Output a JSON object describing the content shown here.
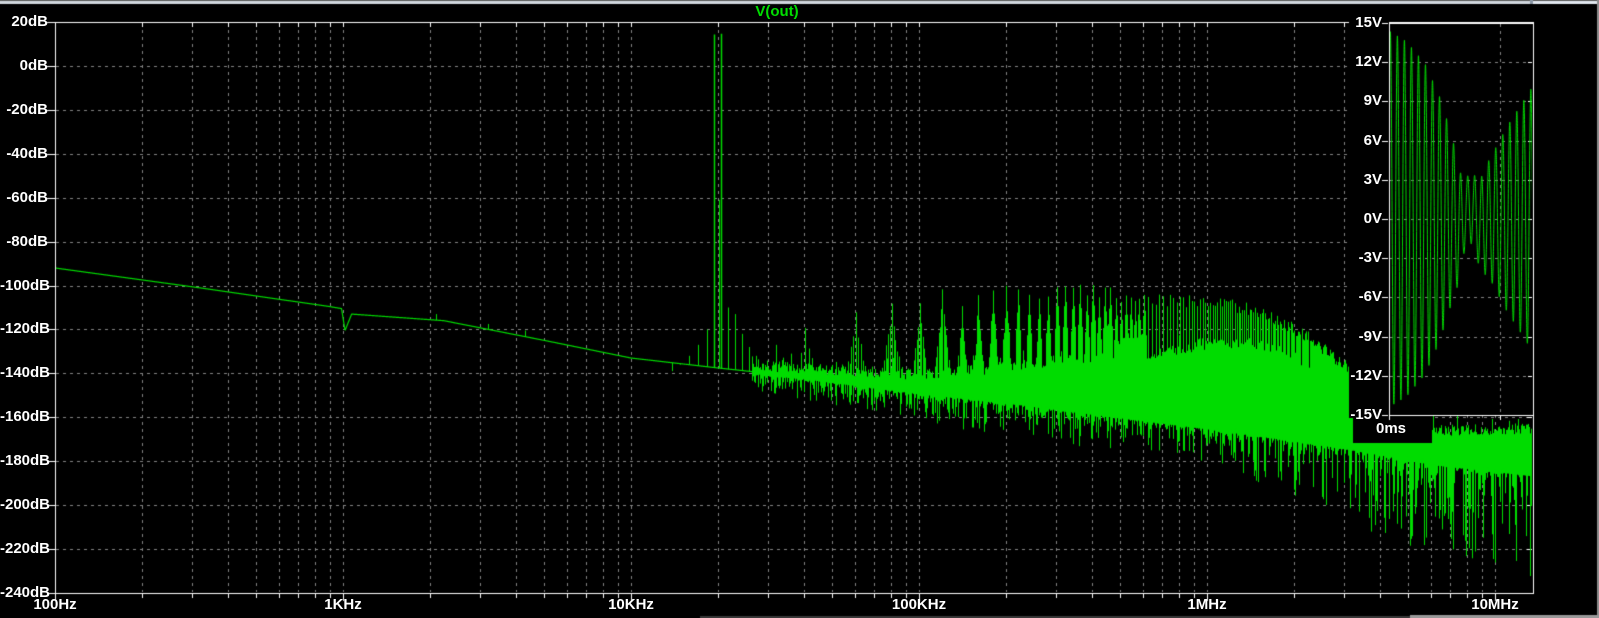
{
  "chart_data": {
    "type": "line",
    "title": "V(out)",
    "colors": {
      "background": "#000000",
      "trace": "#00dc00",
      "grid": "#858585",
      "axis": "#ffffff",
      "label": "#ffffff",
      "title": "#00dd00",
      "chrome_light": "#d0d6dd",
      "chrome_dark": "#5a5a5a",
      "edge_grey": "#9a9a9a"
    },
    "x_axis": {
      "scale": "log",
      "unit": "Hz",
      "min_hz": 100,
      "max_hz": 13600000,
      "major_ticks": [
        {
          "label": "100Hz",
          "hz": 100
        },
        {
          "label": "1KHz",
          "hz": 1000
        },
        {
          "label": "10KHz",
          "hz": 10000
        },
        {
          "label": "100KHz",
          "hz": 100000
        },
        {
          "label": "1MHz",
          "hz": 1000000
        },
        {
          "label": "10MHz",
          "hz": 10000000
        }
      ],
      "minor_tick_multipliers": [
        2,
        3,
        4,
        5,
        6,
        7,
        8,
        9
      ]
    },
    "y_axis": {
      "unit": "dB",
      "max": 20,
      "min": -240,
      "step": -20,
      "tick_labels": [
        "20dB",
        "0dB",
        "-20dB",
        "-40dB",
        "-60dB",
        "-80dB",
        "-100dB",
        "-120dB",
        "-140dB",
        "-160dB",
        "-180dB",
        "-200dB",
        "-220dB",
        "-240dB"
      ]
    },
    "series": {
      "name": "V(out)",
      "baseline_db_vs_logf": [
        [
          2,
          -92
        ],
        [
          2.5,
          -101
        ],
        [
          2.95,
          -109.5
        ],
        [
          2.995,
          -110.5
        ],
        [
          3.007,
          -120.5
        ],
        [
          3.03,
          -113
        ],
        [
          3.35,
          -116
        ],
        [
          3.7,
          -125
        ],
        [
          4,
          -133
        ],
        [
          4.3,
          -137.5
        ],
        [
          4.62,
          -142
        ],
        [
          5,
          -148.5
        ],
        [
          5.35,
          -153.5
        ],
        [
          5.7,
          -159.5
        ],
        [
          6,
          -164.5
        ],
        [
          6.22,
          -168.5
        ],
        [
          6.5,
          -174
        ],
        [
          6.8,
          -181
        ],
        [
          7.14,
          -186
        ]
      ],
      "carriers": [
        {
          "hz": 19400,
          "db": 14.3
        },
        {
          "hz": 20600,
          "db": 14.6
        }
      ],
      "carrier_sideband_spikes": [
        [
          20150,
          -61
        ],
        [
          21800,
          -110
        ],
        [
          23000,
          -113
        ],
        [
          24300,
          -122
        ],
        [
          25700,
          -128
        ],
        [
          27100,
          -132
        ],
        [
          28500,
          -136
        ],
        [
          18300,
          -120
        ],
        [
          17100,
          -127
        ],
        [
          15900,
          -132
        ],
        [
          14800,
          -136
        ],
        [
          13900,
          -139
        ]
      ],
      "low_spikes": [
        [
          2100,
          -113
        ],
        [
          3200,
          -117.5
        ],
        [
          4300,
          -120.5
        ],
        [
          32000,
          -127
        ],
        [
          36000,
          -131
        ]
      ],
      "harmonic_comb": {
        "fundamental_hz": 20100,
        "n_min": 2,
        "n_max": 160,
        "stop_logf": 6.58,
        "tip_db_vs_logf": [
          [
            4.59,
            -117
          ],
          [
            4.8,
            -108.5
          ],
          [
            4.95,
            -111
          ],
          [
            5.03,
            -102.5
          ],
          [
            5.15,
            -107
          ],
          [
            5.3,
            -100.5
          ],
          [
            5.45,
            -104
          ],
          [
            5.6,
            -102
          ],
          [
            5.75,
            -106
          ],
          [
            5.9,
            -107
          ],
          [
            6.05,
            -108
          ],
          [
            6.18,
            -112
          ],
          [
            6.28,
            -118
          ],
          [
            6.38,
            -126
          ],
          [
            6.48,
            -137
          ],
          [
            6.58,
            -150
          ]
        ],
        "sideband_spacing_hz": 1200,
        "sideband_count": 6,
        "sideband_step_db": 5.2
      },
      "noise": {
        "start_logf": 4.42,
        "mass_top_db_vs_logf": [
          [
            4.42,
            -139
          ],
          [
            4.7,
            -141
          ],
          [
            5.0,
            -143
          ],
          [
            5.2,
            -141
          ],
          [
            5.45,
            -137
          ],
          [
            5.75,
            -135
          ],
          [
            6.0,
            -130
          ],
          [
            6.15,
            -128.5
          ],
          [
            6.25,
            -131
          ],
          [
            6.35,
            -138
          ],
          [
            6.45,
            -148
          ],
          [
            6.55,
            -157
          ],
          [
            6.65,
            -163.5
          ],
          [
            6.8,
            -168.5
          ],
          [
            7.14,
            -167.5
          ]
        ],
        "needle_depth_db_vs_logf": [
          [
            4.42,
            8
          ],
          [
            5,
            13
          ],
          [
            5.5,
            16
          ],
          [
            6,
            15
          ],
          [
            6.3,
            25
          ],
          [
            6.6,
            38
          ],
          [
            6.9,
            46
          ],
          [
            7.14,
            46
          ]
        ],
        "rng_seed": 7
      }
    },
    "inset": {
      "y_unit": "V",
      "y_max": 15,
      "y_min": -15,
      "y_step": 3,
      "y_tick_labels": [
        "15V",
        "12V",
        "9V",
        "6V",
        "3V",
        "0V",
        "-3V",
        "-6V",
        "-9V",
        "-12V",
        "-15V"
      ],
      "x_tick_label": "0ms",
      "vertical_gridline_t": 0.77,
      "waveform": {
        "cycles": 20.5,
        "phase": 0.35,
        "envelope_v_vs_t": [
          [
            0,
            14.4
          ],
          [
            0.12,
            13.6
          ],
          [
            0.25,
            11.9
          ],
          [
            0.35,
            9.4
          ],
          [
            0.45,
            5.9
          ],
          [
            0.53,
            2.4
          ],
          [
            0.62,
            3.2
          ],
          [
            0.72,
            5.0
          ],
          [
            0.82,
            7.1
          ],
          [
            0.92,
            8.8
          ],
          [
            1,
            10.2
          ]
        ]
      }
    }
  }
}
